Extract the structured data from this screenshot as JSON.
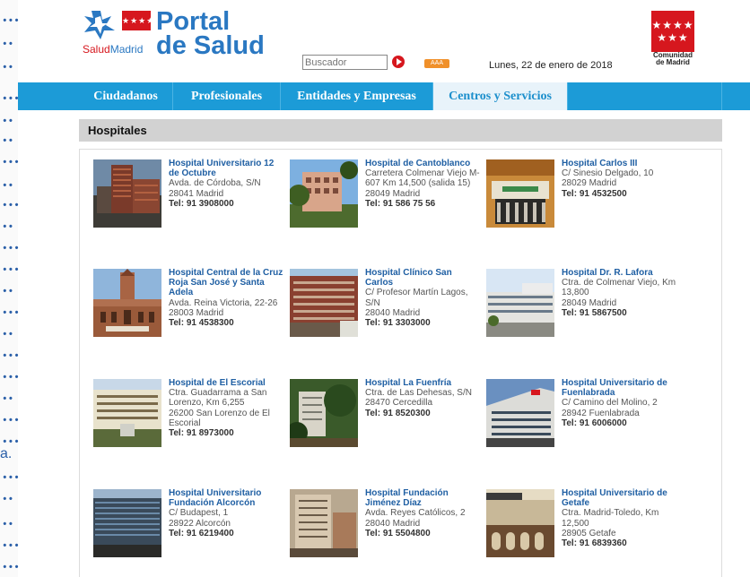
{
  "header": {
    "portal_line1": "Portal",
    "portal_line2": "de Salud",
    "salud": "Salud",
    "madrid": "Madrid",
    "flag_stars": "★★★★",
    "search_placeholder": "Buscador",
    "aaa_label": "AAA",
    "date": "Lunes, 22 de enero de 2018",
    "cm_stars": "★★★★\n★★★",
    "cm_line1": "Comunidad",
    "cm_line2": "de Madrid"
  },
  "nav": {
    "tabs": [
      {
        "label": "Ciudadanos"
      },
      {
        "label": "Profesionales"
      },
      {
        "label": "Entidades y Empresas"
      },
      {
        "label": "Centros y Servicios"
      }
    ]
  },
  "section": {
    "title": "Hospitales"
  },
  "hospitals": [
    {
      "name": "Hospital Universitario 12 de Octubre",
      "address": "Avda. de Córdoba, S/N",
      "cp": "28041 Madrid",
      "tel": "Tel: 91 3908000"
    },
    {
      "name": "Hospital de Cantoblanco",
      "address": "Carretera Colmenar Viejo M-607 Km 14,500 (salida 15)",
      "cp": "28049 Madrid",
      "tel": "Tel: 91 586 75 56"
    },
    {
      "name": "Hospital Carlos III",
      "address": "C/ Sinesio Delgado, 10",
      "cp": "28029 Madrid",
      "tel": "Tel: 91 4532500"
    },
    {
      "name": "Hospital Central de la Cruz Roja San José y Santa Adela",
      "address": "Avda. Reina Victoria, 22-26",
      "cp": "28003 Madrid",
      "tel": "Tel: 91 4538300"
    },
    {
      "name": "Hospital Clínico San Carlos",
      "address": "C/ Profesor Martín Lagos, S/N",
      "cp": "28040 Madrid",
      "tel": "Tel: 91 3303000"
    },
    {
      "name": "Hospital Dr. R. Lafora",
      "address": "Ctra. de Colmenar Viejo, Km 13,800",
      "cp": "28049 Madrid",
      "tel": "Tel: 91 5867500"
    },
    {
      "name": "Hospital de El Escorial",
      "address": "Ctra. Guadarrama a San Lorenzo, Km 6,255",
      "cp": "26200 San Lorenzo de El Escorial",
      "tel": "Tel: 91 8973000"
    },
    {
      "name": "Hospital La Fuenfría",
      "address": "Ctra. de Las Dehesas, S/N",
      "cp": "28470 Cercedilla",
      "tel": "Tel: 91 8520300"
    },
    {
      "name": "Hospital Universitario de Fuenlabrada",
      "address": "C/ Camino del Molino, 2",
      "cp": "28942 Fuenlabrada",
      "tel": "Tel: 91 6006000"
    },
    {
      "name": "Hospital Universitario Fundación Alcorcón",
      "address": "C/ Budapest, 1",
      "cp": "28922 Alcorcón",
      "tel": "Tel: 91 6219400"
    },
    {
      "name": "Hospital Fundación Jiménez Díaz",
      "address": "Avda. Reyes Católicos, 2",
      "cp": "28040 Madrid",
      "tel": "Tel: 91 5504800"
    },
    {
      "name": "Hospital Universitario de Getafe",
      "address": "Ctra. Madrid-Toledo, Km 12,500",
      "cp": "28905 Getafe",
      "tel": "Tel: 91 6839360"
    }
  ],
  "left_strip": {
    "letter": "a."
  },
  "colors": {
    "nav_blue": "#1c9bd7",
    "brand_red": "#d6171e",
    "link_blue": "#1f5fa3"
  }
}
